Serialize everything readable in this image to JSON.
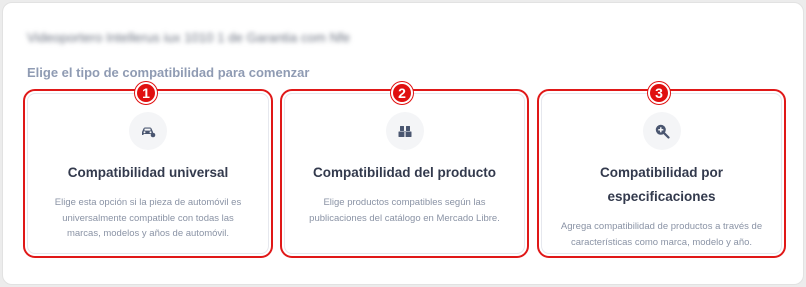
{
  "header": {
    "blurred_title": "Videoportero Intellerus iux 1010 1 de Garantia com Nfe",
    "subtitle": "Elige el tipo de compatibilidad para comenzar"
  },
  "cards": [
    {
      "badge": "1",
      "icon": "car-icon",
      "title": "Compatibilidad universal",
      "description": "Elige esta opción si la pieza de automóvil es universalmente compatible con todas las marcas, modelos y años de automóvil."
    },
    {
      "badge": "2",
      "icon": "boxes-icon",
      "title": "Compatibilidad del producto",
      "description": "Elige productos compatibles según las publicaciones del catálogo en Mercado Libre."
    },
    {
      "badge": "3",
      "icon": "search-plus-icon",
      "title": "Compatibilidad por especificaciones",
      "description": "Agrega compatibilidad de productos a través de características como marca, modelo y año."
    }
  ],
  "colors": {
    "highlight": "#e01818",
    "title_text": "#333a4d",
    "muted_text": "#8a93a5"
  }
}
